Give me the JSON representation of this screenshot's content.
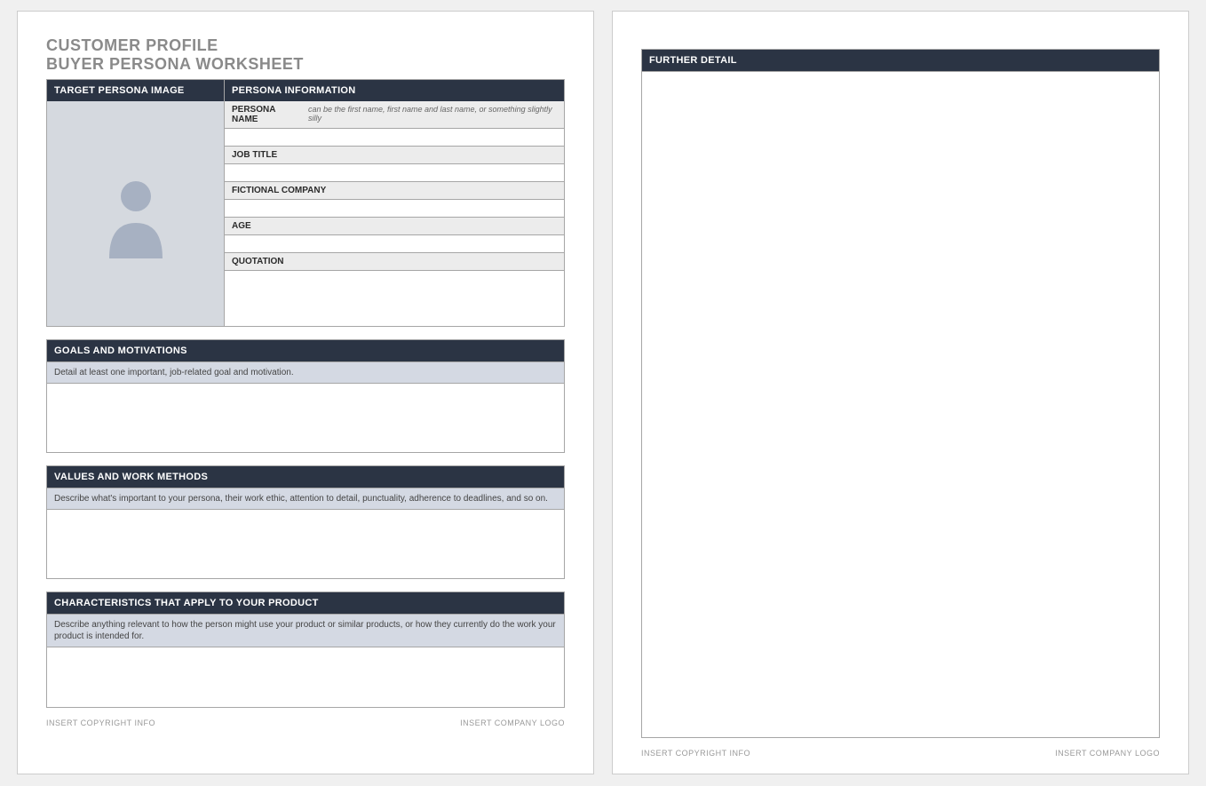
{
  "title": {
    "line1": "CUSTOMER PROFILE",
    "line2": "BUYER PERSONA WORKSHEET"
  },
  "headers": {
    "target_image": "TARGET PERSONA IMAGE",
    "persona_info": "PERSONA INFORMATION",
    "goals": "GOALS AND MOTIVATIONS",
    "values": "VALUES AND WORK METHODS",
    "characteristics": "CHARACTERISTICS THAT APPLY TO YOUR PRODUCT",
    "further_detail": "FURTHER DETAIL"
  },
  "fields": {
    "persona_name": {
      "label": "PERSONA NAME",
      "hint": "can be the first name, first name and last name, or something slightly silly"
    },
    "job_title": {
      "label": "JOB TITLE"
    },
    "fictional_company": {
      "label": "FICTIONAL COMPANY"
    },
    "age": {
      "label": "AGE"
    },
    "quotation": {
      "label": "QUOTATION"
    }
  },
  "hints": {
    "goals": "Detail at least one important, job-related goal and motivation.",
    "values": "Describe what's important to your persona, their work ethic, attention to detail, punctuality, adherence to deadlines, and so on.",
    "characteristics": "Describe anything relevant to how the person might use your product or similar products, or how they currently do the work your product is intended for."
  },
  "footer": {
    "left": "INSERT COPYRIGHT INFO",
    "right": "INSERT COMPANY LOGO"
  }
}
